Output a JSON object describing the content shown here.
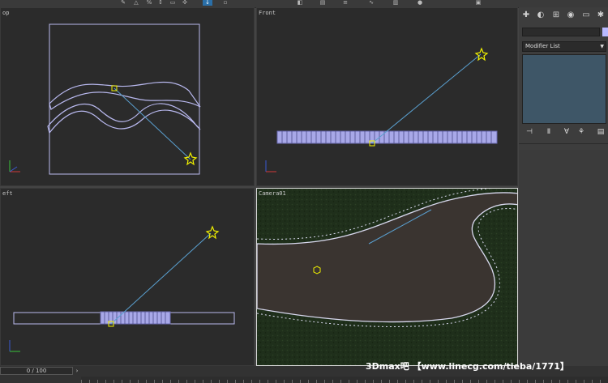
{
  "toolbar": {
    "icons": [
      "snap-icon",
      "angle-snap-icon",
      "percent-snap-icon",
      "spinner-snap-icon",
      "select-icon",
      "move-icon",
      "rotate-icon",
      "scale-icon",
      "mirror-icon",
      "align-icon",
      "layers-icon",
      "curve-editor-icon",
      "schematic-icon",
      "material-editor-icon",
      "render-setup-icon"
    ]
  },
  "viewports": {
    "top": {
      "label": "op"
    },
    "front": {
      "label": "Front"
    },
    "left": {
      "label": "eft"
    },
    "camera": {
      "label": "Camera01"
    }
  },
  "command_panel": {
    "tabs": [
      "create-tab-icon",
      "modify-tab-icon",
      "hierarchy-tab-icon",
      "motion-tab-icon",
      "display-tab-icon",
      "utilities-tab-icon"
    ],
    "object_color": "#b9b9ff",
    "modifier_list": "Modifier List",
    "stack_tools": [
      "pin-stack-icon",
      "show-end-result-icon",
      "make-unique-icon",
      "remove-modifier-icon",
      "configure-sets-icon"
    ]
  },
  "timeline": {
    "position": "0 / 100"
  },
  "watermark": {
    "text": "3Dmax吧 【www.linecg.com/tieba/1771】"
  },
  "colors": {
    "spline": "#b8b8ee",
    "camera": "#f0f000",
    "target_line": "#5aa0d0",
    "axis_x": "#d03a3a",
    "axis_y": "#3ac03a",
    "axis_z": "#3a5ad0",
    "road": "#3a3430",
    "grass": "#1e2e1a"
  }
}
